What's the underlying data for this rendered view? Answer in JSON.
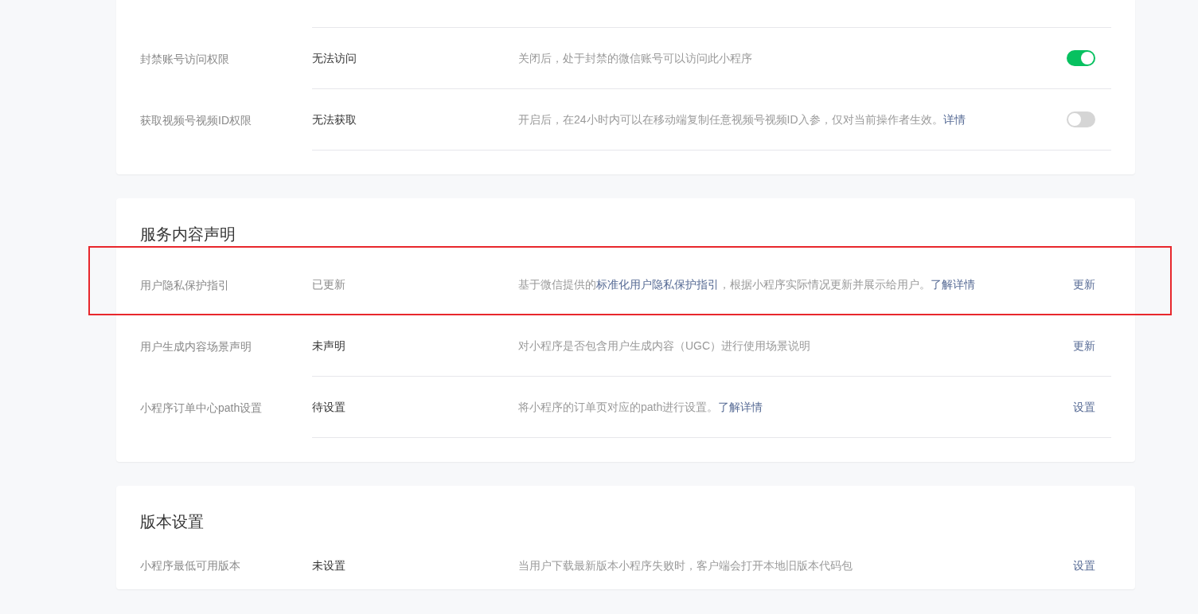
{
  "sections": [
    {
      "rows": [
        {
          "label": "封禁账号访问权限",
          "status": "无法访问",
          "status_muted": false,
          "highlighted": false,
          "description": [
            {
              "text": "关闭后，处于封禁的微信账号可以访问此小程序",
              "link": false
            }
          ],
          "action": {
            "kind": "toggle",
            "on": true
          }
        },
        {
          "label": "获取视频号视频ID权限",
          "status": "无法获取",
          "status_muted": false,
          "highlighted": false,
          "description": [
            {
              "text": "开启后，在24小时内可以在移动端复制任意视频号视频ID入参，仅对当前操作者生效。",
              "link": false
            },
            {
              "text": "详情",
              "link": true
            }
          ],
          "action": {
            "kind": "toggle",
            "on": false
          }
        }
      ]
    },
    {
      "title": "服务内容声明",
      "rows": [
        {
          "label": "用户隐私保护指引",
          "status": "已更新",
          "status_muted": true,
          "highlighted": true,
          "description": [
            {
              "text": "基于微信提供的",
              "link": false
            },
            {
              "text": "标准化用户隐私保护指引",
              "link": true
            },
            {
              "text": "，根据小程序实际情况更新并展示给用户。",
              "link": false
            },
            {
              "text": "了解详情",
              "link": true
            }
          ],
          "action": {
            "kind": "link",
            "text": "更新"
          }
        },
        {
          "label": "用户生成内容场景声明",
          "status": "未声明",
          "status_muted": false,
          "highlighted": false,
          "description": [
            {
              "text": "对小程序是否包含用户生成内容（UGC）进行使用场景说明",
              "link": false
            }
          ],
          "action": {
            "kind": "link",
            "text": "更新"
          }
        },
        {
          "label": "小程序订单中心path设置",
          "status": "待设置",
          "status_muted": false,
          "highlighted": false,
          "description": [
            {
              "text": "将小程序的订单页对应的path进行设置。",
              "link": false
            },
            {
              "text": "了解详情",
              "link": true
            }
          ],
          "action": {
            "kind": "link",
            "text": "设置"
          }
        }
      ]
    },
    {
      "title": "版本设置",
      "rows": [
        {
          "label": "小程序最低可用版本",
          "status": "未设置",
          "status_muted": false,
          "highlighted": false,
          "description": [
            {
              "text": "当用户下载最新版本小程序失败时，客户端会打开本地旧版本代码包",
              "link": false
            }
          ],
          "action": {
            "kind": "link",
            "text": "设置"
          }
        }
      ]
    }
  ]
}
